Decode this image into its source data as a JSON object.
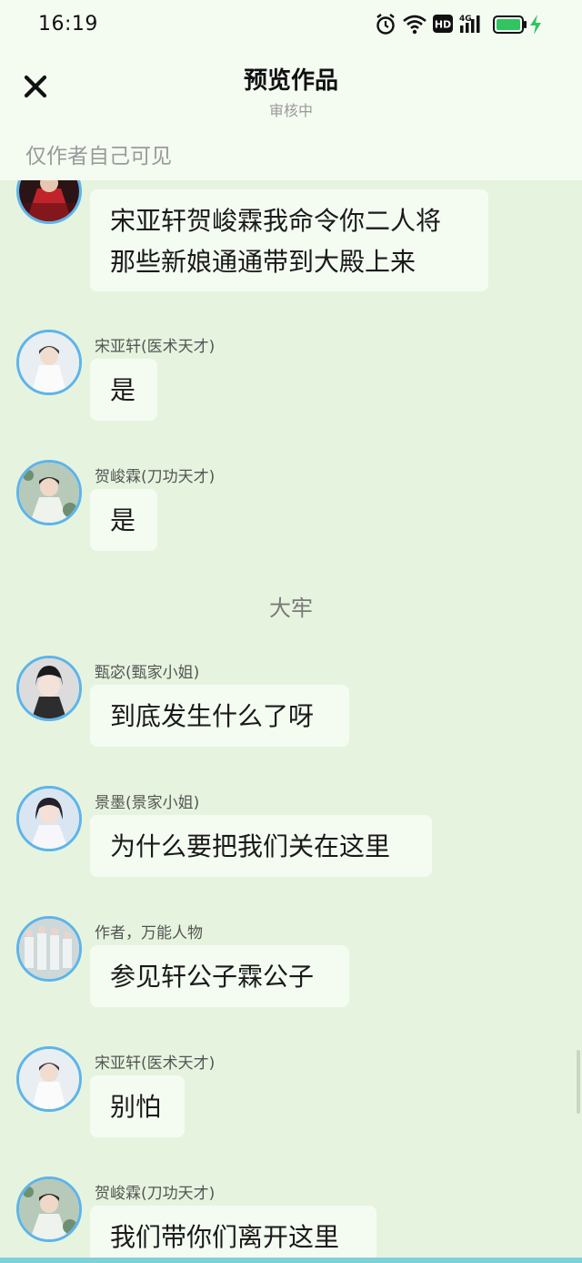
{
  "status_bar": {
    "time": "16:19",
    "icons": [
      "alarm-icon",
      "wifi-icon",
      "hd-icon",
      "signal-4g-icon",
      "battery-icon",
      "charging-icon"
    ],
    "hd_label": "HD",
    "network_label": "4G",
    "battery_color": "#31c460"
  },
  "header": {
    "title": "预览作品",
    "subtitle": "审核中",
    "visibility_note": "仅作者自己可见",
    "close_icon": "close-icon"
  },
  "messages": [
    {
      "sender": "",
      "text_lines": [
        "宋亚轩贺峻霖我命令你二人将",
        "那些新娘通通带到大殿上来"
      ]
    },
    {
      "sender": "宋亚轩(医术天才)",
      "text_lines": [
        "是"
      ]
    },
    {
      "sender": "贺峻霖(刀功天才)",
      "text_lines": [
        "是"
      ]
    },
    {
      "scene": "大牢"
    },
    {
      "sender": "甄宓(甄家小姐)",
      "text_lines": [
        "到底发生什么了呀"
      ]
    },
    {
      "sender": "景墨(景家小姐)",
      "text_lines": [
        "为什么要把我们关在这里"
      ]
    },
    {
      "sender": "作者，万能人物",
      "text_lines": [
        "参见轩公子霖公子"
      ]
    },
    {
      "sender": "宋亚轩(医术天才)",
      "text_lines": [
        "别怕"
      ]
    },
    {
      "sender": "贺峻霖(刀功天才)",
      "text_lines": [
        "我们带你们离开这里"
      ]
    }
  ],
  "colors": {
    "background": "#e6f4df",
    "bubble": "#f4fcf2",
    "avatar_ring": "#5db4ea"
  }
}
